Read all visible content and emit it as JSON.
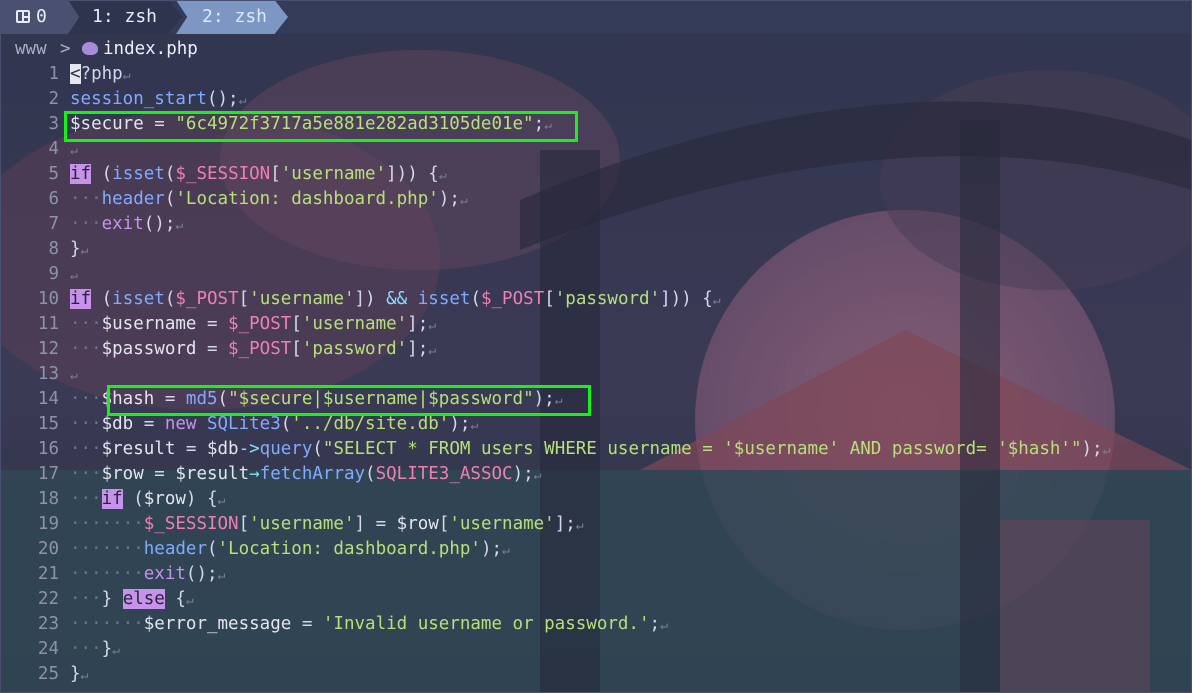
{
  "tabs": [
    {
      "label": "0",
      "icon": "layout-icon"
    },
    {
      "label": "1: zsh"
    },
    {
      "label": "2: zsh",
      "active": true
    }
  ],
  "breadcrumb": {
    "dir": "www",
    "separator": ">",
    "icon": "php-icon",
    "file": "index.php"
  },
  "colors": {
    "highlight": "#19f019",
    "keyword": "#c792ea",
    "function": "#82aaff",
    "string": "#b7e07a",
    "constant": "#f07fb4"
  },
  "lines": [
    {
      "num": "1",
      "tokens": [
        {
          "t": "<",
          "c": "cur"
        },
        {
          "t": "?php",
          "c": "plain"
        }
      ]
    },
    {
      "num": "2",
      "tokens": [
        {
          "t": "session_start",
          "c": "fn"
        },
        {
          "t": "();",
          "c": "plain"
        }
      ]
    },
    {
      "num": "3",
      "tokens": [
        {
          "t": "$secure",
          "c": "var"
        },
        {
          "t": " = ",
          "c": "plain"
        },
        {
          "t": "\"6c4972f3717a5e881e282ad3105de01e\"",
          "c": "str"
        },
        {
          "t": ";",
          "c": "plain"
        }
      ]
    },
    {
      "num": "4",
      "tokens": []
    },
    {
      "num": "5",
      "tokens": [
        {
          "t": "if",
          "c": "kwbg"
        },
        {
          "t": " (",
          "c": "plain"
        },
        {
          "t": "isset",
          "c": "fn"
        },
        {
          "t": "(",
          "c": "plain"
        },
        {
          "t": "$_SESSION",
          "c": "const"
        },
        {
          "t": "[",
          "c": "plain"
        },
        {
          "t": "'username'",
          "c": "str"
        },
        {
          "t": "])) {",
          "c": "plain"
        }
      ]
    },
    {
      "num": "6",
      "tokens": [
        {
          "t": "···",
          "c": "dot"
        },
        {
          "t": "header",
          "c": "fn"
        },
        {
          "t": "(",
          "c": "plain"
        },
        {
          "t": "'Location: dashboard.php'",
          "c": "str"
        },
        {
          "t": ");",
          "c": "plain"
        }
      ]
    },
    {
      "num": "7",
      "tokens": [
        {
          "t": "···",
          "c": "dot"
        },
        {
          "t": "exit",
          "c": "kw"
        },
        {
          "t": "();",
          "c": "plain"
        }
      ]
    },
    {
      "num": "8",
      "tokens": [
        {
          "t": "}",
          "c": "plain"
        }
      ]
    },
    {
      "num": "9",
      "tokens": []
    },
    {
      "num": "10",
      "tokens": [
        {
          "t": "if",
          "c": "kwbg"
        },
        {
          "t": " (",
          "c": "plain"
        },
        {
          "t": "isset",
          "c": "fn"
        },
        {
          "t": "(",
          "c": "plain"
        },
        {
          "t": "$_POST",
          "c": "const"
        },
        {
          "t": "[",
          "c": "plain"
        },
        {
          "t": "'username'",
          "c": "str"
        },
        {
          "t": "]) ",
          "c": "plain"
        },
        {
          "t": "&&",
          "c": "op"
        },
        {
          "t": " ",
          "c": "plain"
        },
        {
          "t": "isset",
          "c": "fn"
        },
        {
          "t": "(",
          "c": "plain"
        },
        {
          "t": "$_POST",
          "c": "const"
        },
        {
          "t": "[",
          "c": "plain"
        },
        {
          "t": "'password'",
          "c": "str"
        },
        {
          "t": "])) {",
          "c": "plain"
        }
      ]
    },
    {
      "num": "11",
      "tokens": [
        {
          "t": "···",
          "c": "dot"
        },
        {
          "t": "$username",
          "c": "var"
        },
        {
          "t": " = ",
          "c": "plain"
        },
        {
          "t": "$_POST",
          "c": "const"
        },
        {
          "t": "[",
          "c": "plain"
        },
        {
          "t": "'username'",
          "c": "str"
        },
        {
          "t": "];",
          "c": "plain"
        }
      ]
    },
    {
      "num": "12",
      "tokens": [
        {
          "t": "···",
          "c": "dot"
        },
        {
          "t": "$password",
          "c": "var"
        },
        {
          "t": " = ",
          "c": "plain"
        },
        {
          "t": "$_POST",
          "c": "const"
        },
        {
          "t": "[",
          "c": "plain"
        },
        {
          "t": "'password'",
          "c": "str"
        },
        {
          "t": "];",
          "c": "plain"
        }
      ]
    },
    {
      "num": "13",
      "tokens": []
    },
    {
      "num": "14",
      "tokens": [
        {
          "t": "···",
          "c": "dot"
        },
        {
          "t": "$hash",
          "c": "var"
        },
        {
          "t": " = ",
          "c": "plain"
        },
        {
          "t": "md5",
          "c": "fn"
        },
        {
          "t": "(",
          "c": "plain"
        },
        {
          "t": "\"$secure|$username|$password\"",
          "c": "str"
        },
        {
          "t": ");",
          "c": "plain"
        }
      ]
    },
    {
      "num": "15",
      "tokens": [
        {
          "t": "···",
          "c": "dot"
        },
        {
          "t": "$db",
          "c": "var"
        },
        {
          "t": " = ",
          "c": "plain"
        },
        {
          "t": "new",
          "c": "kw"
        },
        {
          "t": " ",
          "c": "plain"
        },
        {
          "t": "SQLite3",
          "c": "fn"
        },
        {
          "t": "(",
          "c": "plain"
        },
        {
          "t": "'../db/site.db'",
          "c": "str"
        },
        {
          "t": ");",
          "c": "plain"
        }
      ]
    },
    {
      "num": "16",
      "tokens": [
        {
          "t": "···",
          "c": "dot"
        },
        {
          "t": "$result",
          "c": "var"
        },
        {
          "t": " = ",
          "c": "plain"
        },
        {
          "t": "$db",
          "c": "var"
        },
        {
          "t": "->",
          "c": "op"
        },
        {
          "t": "query",
          "c": "fn"
        },
        {
          "t": "(",
          "c": "plain"
        },
        {
          "t": "\"SELECT * FROM users WHERE username = '$username' AND password= '$hash'\"",
          "c": "str"
        },
        {
          "t": ");",
          "c": "plain"
        }
      ]
    },
    {
      "num": "17",
      "tokens": [
        {
          "t": "···",
          "c": "dot"
        },
        {
          "t": "$row",
          "c": "var"
        },
        {
          "t": " = ",
          "c": "plain"
        },
        {
          "t": "$result",
          "c": "var"
        },
        {
          "t": "→",
          "c": "op"
        },
        {
          "t": "fetchArray",
          "c": "fn"
        },
        {
          "t": "(",
          "c": "plain"
        },
        {
          "t": "SQLITE3_ASSOC",
          "c": "const"
        },
        {
          "t": ");",
          "c": "plain"
        }
      ]
    },
    {
      "num": "18",
      "tokens": [
        {
          "t": "···",
          "c": "dot"
        },
        {
          "t": "if",
          "c": "kwbg"
        },
        {
          "t": " (",
          "c": "plain"
        },
        {
          "t": "$row",
          "c": "var"
        },
        {
          "t": ") {",
          "c": "plain"
        }
      ]
    },
    {
      "num": "19",
      "tokens": [
        {
          "t": "·······",
          "c": "dot"
        },
        {
          "t": "$_SESSION",
          "c": "const"
        },
        {
          "t": "[",
          "c": "plain"
        },
        {
          "t": "'username'",
          "c": "str"
        },
        {
          "t": "] = ",
          "c": "plain"
        },
        {
          "t": "$row",
          "c": "var"
        },
        {
          "t": "[",
          "c": "plain"
        },
        {
          "t": "'username'",
          "c": "str"
        },
        {
          "t": "];",
          "c": "plain"
        }
      ]
    },
    {
      "num": "20",
      "tokens": [
        {
          "t": "·······",
          "c": "dot"
        },
        {
          "t": "header",
          "c": "fn"
        },
        {
          "t": "(",
          "c": "plain"
        },
        {
          "t": "'Location: dashboard.php'",
          "c": "str"
        },
        {
          "t": ");",
          "c": "plain"
        }
      ]
    },
    {
      "num": "21",
      "tokens": [
        {
          "t": "·······",
          "c": "dot"
        },
        {
          "t": "exit",
          "c": "kw"
        },
        {
          "t": "();",
          "c": "plain"
        }
      ]
    },
    {
      "num": "22",
      "tokens": [
        {
          "t": "···",
          "c": "dot"
        },
        {
          "t": "} ",
          "c": "plain"
        },
        {
          "t": "else",
          "c": "kwbg"
        },
        {
          "t": " {",
          "c": "plain"
        }
      ]
    },
    {
      "num": "23",
      "tokens": [
        {
          "t": "·······",
          "c": "dot"
        },
        {
          "t": "$error_message",
          "c": "var"
        },
        {
          "t": " = ",
          "c": "plain"
        },
        {
          "t": "'Invalid username or password.'",
          "c": "str"
        },
        {
          "t": ";",
          "c": "plain"
        }
      ]
    },
    {
      "num": "24",
      "tokens": [
        {
          "t": "···",
          "c": "dot"
        },
        {
          "t": "}",
          "c": "plain"
        }
      ]
    },
    {
      "num": "25",
      "tokens": [
        {
          "t": "}",
          "c": "plain"
        }
      ]
    }
  ],
  "eol_marker": "↵"
}
